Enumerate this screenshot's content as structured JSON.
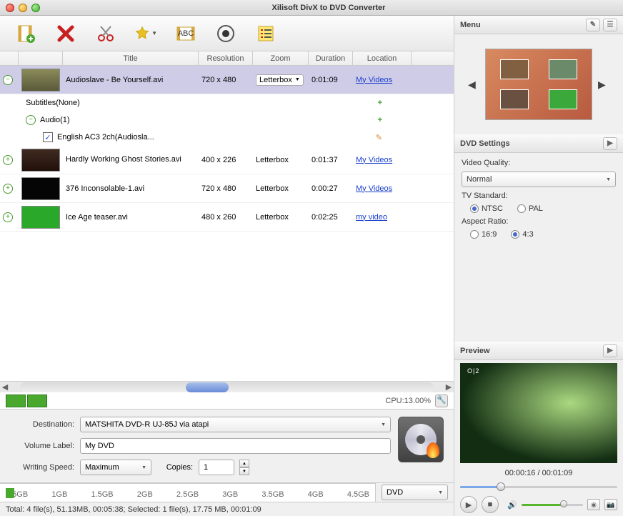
{
  "window": {
    "title": "Xilisoft DivX to DVD Converter"
  },
  "columns": {
    "title": "Title",
    "resolution": "Resolution",
    "zoom": "Zoom",
    "duration": "Duration",
    "location": "Location"
  },
  "files": [
    {
      "title": "Audioslave - Be Yourself.avi",
      "resolution": "720 x 480",
      "zoom": "Letterbox",
      "duration": "0:01:09",
      "location": "My Videos",
      "selected": true,
      "thumb_color": "#8a8a5a"
    },
    {
      "title": "Hardly Working  Ghost Stories.avi",
      "resolution": "400 x 226",
      "zoom": "Letterbox",
      "duration": "0:01:37",
      "location": "My Videos",
      "thumb_color": "#402a20"
    },
    {
      "title": "376 Inconsolable-1.avi",
      "resolution": "720 x 480",
      "zoom": "Letterbox",
      "duration": "0:00:27",
      "location": "My Videos",
      "thumb_color": "#050505"
    },
    {
      "title": "Ice Age teaser.avi",
      "resolution": "480 x 260",
      "zoom": "Letterbox",
      "duration": "0:02:25",
      "location": "my video",
      "thumb_color": "#2aa82a"
    }
  ],
  "subtitles_label": "Subtitles(None)",
  "audio_label": "Audio(1)",
  "audio_track": "English AC3 2ch(Audiosla...",
  "cpu": {
    "label": "CPU:13.00%"
  },
  "settings": {
    "destination_label": "Destination:",
    "destination_value": "MATSHITA DVD-R UJ-85J via atapi",
    "volume_label": "Volume Label:",
    "volume_value": "My DVD",
    "speed_label": "Writing Speed:",
    "speed_value": "Maximum",
    "copies_label": "Copies:",
    "copies_value": "1",
    "format": "DVD"
  },
  "capacity_ticks": [
    "0.5GB",
    "1GB",
    "1.5GB",
    "2GB",
    "2.5GB",
    "3GB",
    "3.5GB",
    "4GB",
    "4.5GB"
  ],
  "status": "Total: 4 file(s), 51.13MB,  00:05:38; Selected: 1 file(s), 17.75 MB,  00:01:09",
  "menu": {
    "header": "Menu"
  },
  "dvd": {
    "header": "DVD Settings",
    "video_quality_label": "Video Quality:",
    "video_quality_value": "Normal",
    "tv_label": "TV Standard:",
    "tv_ntsc": "NTSC",
    "tv_pal": "PAL",
    "aspect_label": "Aspect Ratio:",
    "aspect_169": "16:9",
    "aspect_43": "4:3"
  },
  "preview": {
    "header": "Preview",
    "time": "00:00:16 / 00:01:09"
  }
}
